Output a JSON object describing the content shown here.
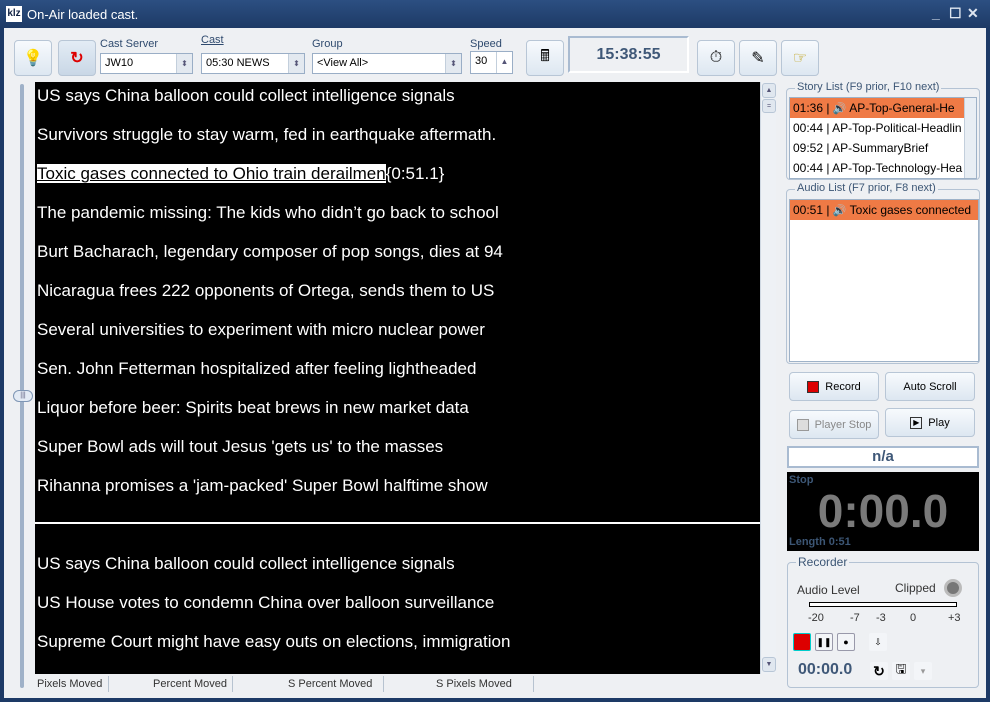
{
  "window": {
    "title": "On-Air loaded cast.",
    "logo": "klz",
    "controls": [
      "_",
      "☐",
      "✕"
    ]
  },
  "toolbar": {
    "cast_server": {
      "label": "Cast Server",
      "value": "JW10"
    },
    "cast": {
      "label": "Cast",
      "value": "05:30 NEWS"
    },
    "group": {
      "label": "Group",
      "value": "<View All>"
    },
    "speed": {
      "label": "Speed",
      "value": "30"
    },
    "clock": "15:38:55",
    "icons": [
      "lightbulb-icon",
      "reload-icon",
      "calculator-icon",
      "stopwatch-icon",
      "edit-icon",
      "pointer-icon"
    ]
  },
  "prompter": {
    "lines": [
      "US says China balloon could collect intelligence signals",
      "Survivors struggle to stay warm, fed in earthquake aftermath.",
      "Toxic gases connected to Ohio train derailmen",
      "The pandemic missing: The kids who didn’t go back to school",
      "Burt Bacharach, legendary composer of pop songs, dies at 94",
      "Nicaragua frees 222 opponents of Ortega, sends them to US",
      "Several universities to experiment with micro nuclear power",
      "Sen. John Fetterman hospitalized after feeling lightheaded",
      "Liquor before beer: Spirits beat brews in new market data",
      "Super Bowl ads will tout Jesus 'gets us' to the masses",
      "Rihanna promises a 'jam-packed' Super Bowl halftime show"
    ],
    "highlight_suffix": "{0:51.1}",
    "lines_after": [
      "US says China balloon could collect intelligence signals",
      "US House votes to condemn China over balloon surveillance",
      "Supreme Court might have easy outs on elections, immigration"
    ]
  },
  "statusbar": [
    "Pixels Moved",
    "Percent Moved",
    "S Percent Moved",
    "S Pixels Moved"
  ],
  "story_list": {
    "label": "Story List (F9 prior, F10 next)",
    "items": [
      {
        "time": "01:36",
        "title": "AP-Top-General-He",
        "audio": true,
        "selected": true
      },
      {
        "time": "00:44",
        "title": "AP-Top-Political-Headlin",
        "audio": false,
        "selected": false
      },
      {
        "time": "09:52",
        "title": "AP-SummaryBrief",
        "audio": false,
        "selected": false
      },
      {
        "time": "00:44",
        "title": "AP-Top-Technology-Hea",
        "audio": false,
        "selected": false
      }
    ]
  },
  "audio_list": {
    "label": "Audio List (F7 prior, F8 next)",
    "items": [
      {
        "time": "00:51",
        "title": "Toxic gases connected",
        "selected": true
      }
    ]
  },
  "buttons": {
    "record": "Record",
    "auto_scroll": "Auto Scroll",
    "player_stop": "Player Stop",
    "play": "Play"
  },
  "player": {
    "name": "n/a",
    "state": "Stop",
    "time": "0:00.0",
    "length": "Length 0:51"
  },
  "recorder": {
    "label": "Recorder",
    "audio_level": "Audio Level",
    "clipped": "Clipped",
    "level": 0,
    "scale": [
      "-20",
      "-7",
      "-3",
      "0",
      "+3"
    ],
    "time": "00:00.0"
  },
  "colors": {
    "selected": "#ef7a45",
    "titlebar": "#1d3a66",
    "prompter_bg": "#000000"
  }
}
